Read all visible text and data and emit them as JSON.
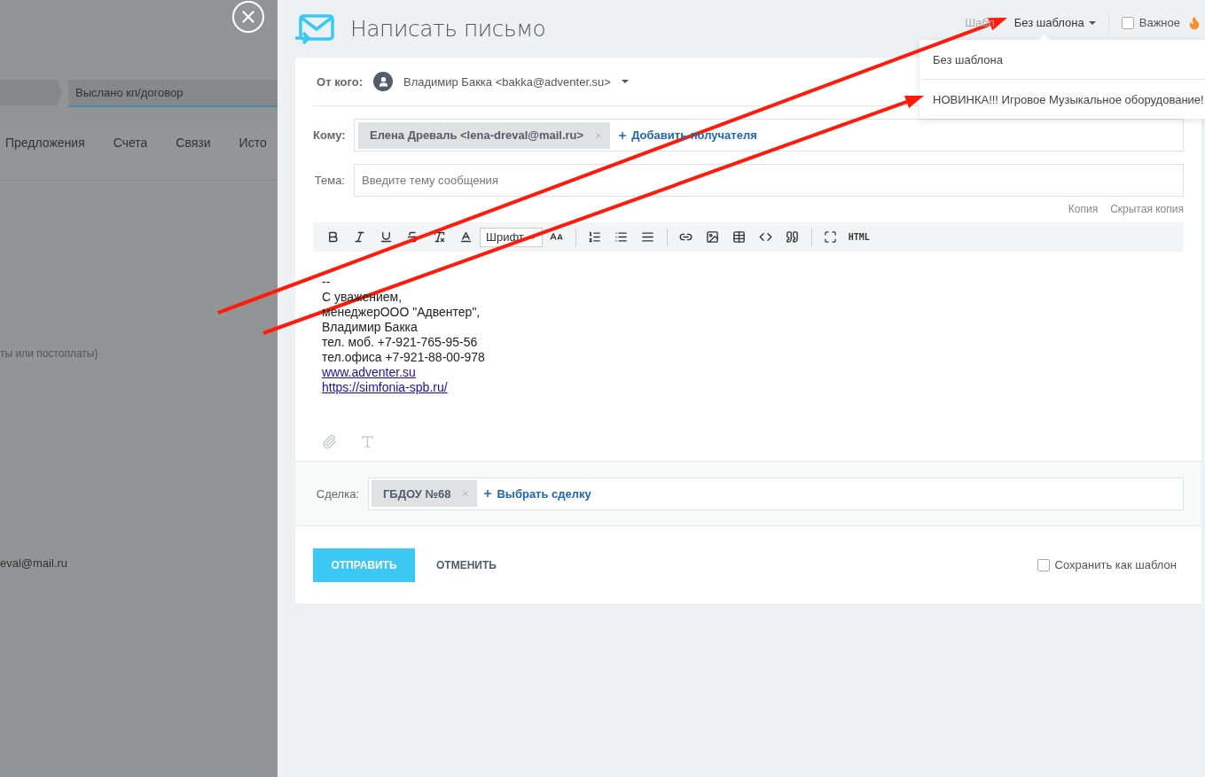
{
  "background_page": {
    "stage": "Выслано кп/договор",
    "tabs": [
      "Предложения",
      "Счета",
      "Связи",
      "Исто"
    ],
    "note": "ты или постоплаты)",
    "email": "eval@mail.ru"
  },
  "header": {
    "title": "Написать письмо",
    "template_label": "Шабл",
    "template_value": "Без шаблона",
    "important": {
      "label": "Важное",
      "checked": false
    }
  },
  "template_menu": {
    "items": [
      "Без шаблона",
      "НОВИНКА!!! Игровое Музыкальное оборудование!"
    ]
  },
  "form": {
    "from": {
      "label": "От кого:",
      "value": "Владимир Бакка <bakka@adventer.su>"
    },
    "to": {
      "label": "Кому:",
      "recipients": [
        "Елена Древаль <lena-dreval@mail.ru>"
      ],
      "add": "Добавить получателя"
    },
    "subject": {
      "label": "Тема:",
      "placeholder": "Введите тему сообщения"
    },
    "copy_links": [
      "Копия",
      "Скрытая копия"
    ],
    "toolbar": {
      "font": "Шрифт",
      "html": "HTML"
    },
    "body": [
      {
        "kind": "line",
        "text": "--"
      },
      {
        "kind": "line",
        "text": "С уважением,"
      },
      {
        "kind": "line",
        "text": "менеджерООО \"Адвентер\","
      },
      {
        "kind": "line",
        "text": "Владимир Бакка"
      },
      {
        "kind": "line",
        "text": "тел. моб. +7-921-765-95-56"
      },
      {
        "kind": "line",
        "text": "тел.офиса +7-921-88-00-978"
      },
      {
        "kind": "link",
        "text": "www.adventer.su"
      },
      {
        "kind": "link",
        "text": "https://simfonia-spb.ru/"
      }
    ],
    "deal": {
      "label": "Сделка:",
      "items": [
        "ГБДОУ №68"
      ],
      "add": "Выбрать сделку"
    },
    "send": "ОТПРАВИТЬ",
    "cancel": "ОТМЕНИТЬ",
    "save_template": {
      "label": "Сохранить как шаблон",
      "checked": false
    }
  }
}
